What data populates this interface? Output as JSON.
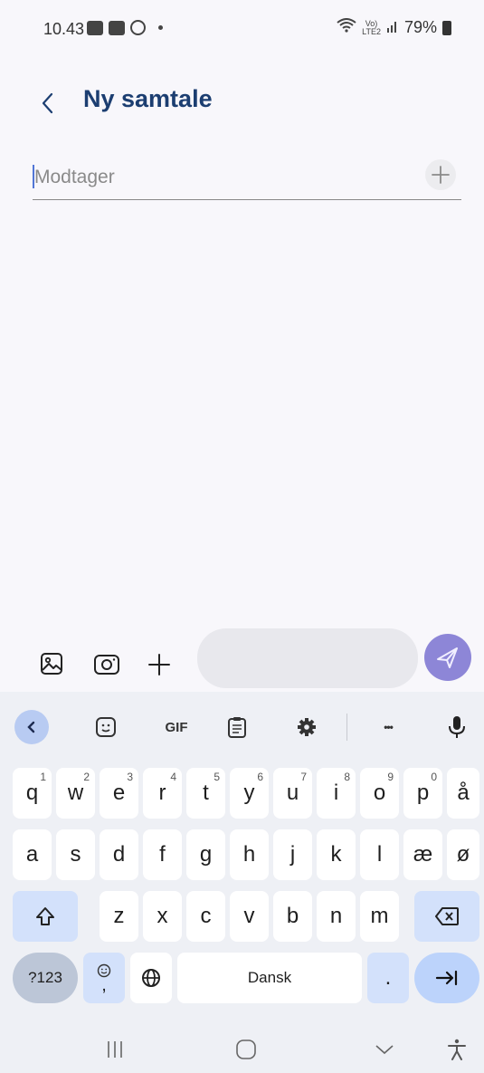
{
  "status_bar": {
    "time": "10.43",
    "battery": "79%",
    "network": "LTE2"
  },
  "header": {
    "title": "Ny samtale"
  },
  "recipient": {
    "placeholder": "Modtager"
  },
  "compose": {
    "message_placeholder": ""
  },
  "keyboard": {
    "toolbar": [
      "back",
      "sticker",
      "GIF",
      "clipboard",
      "settings",
      "more",
      "mic"
    ],
    "gif_label": "GIF",
    "more_label": "•••",
    "row1": [
      {
        "key": "q",
        "hint": "1"
      },
      {
        "key": "w",
        "hint": "2"
      },
      {
        "key": "e",
        "hint": "3"
      },
      {
        "key": "r",
        "hint": "4"
      },
      {
        "key": "t",
        "hint": "5"
      },
      {
        "key": "y",
        "hint": "6"
      },
      {
        "key": "u",
        "hint": "7"
      },
      {
        "key": "i",
        "hint": "8"
      },
      {
        "key": "o",
        "hint": "9"
      },
      {
        "key": "p",
        "hint": "0"
      },
      {
        "key": "å",
        "hint": ""
      }
    ],
    "row2": [
      "a",
      "s",
      "d",
      "f",
      "g",
      "h",
      "j",
      "k",
      "l",
      "æ",
      "ø"
    ],
    "row3": [
      "z",
      "x",
      "c",
      "v",
      "b",
      "n",
      "m"
    ],
    "symbols_label": "?123",
    "comma_label": ",",
    "space_label": "Dansk",
    "period_label": "."
  },
  "icons": {
    "back": "chevron-left-icon",
    "add": "plus-icon",
    "gallery": "image-icon",
    "camera": "camera-icon",
    "attach": "plus-icon",
    "send": "send-icon",
    "shift": "shift-icon",
    "backspace": "backspace-icon",
    "emoji": "emoji-icon",
    "globe": "globe-icon",
    "enter": "next-icon"
  }
}
